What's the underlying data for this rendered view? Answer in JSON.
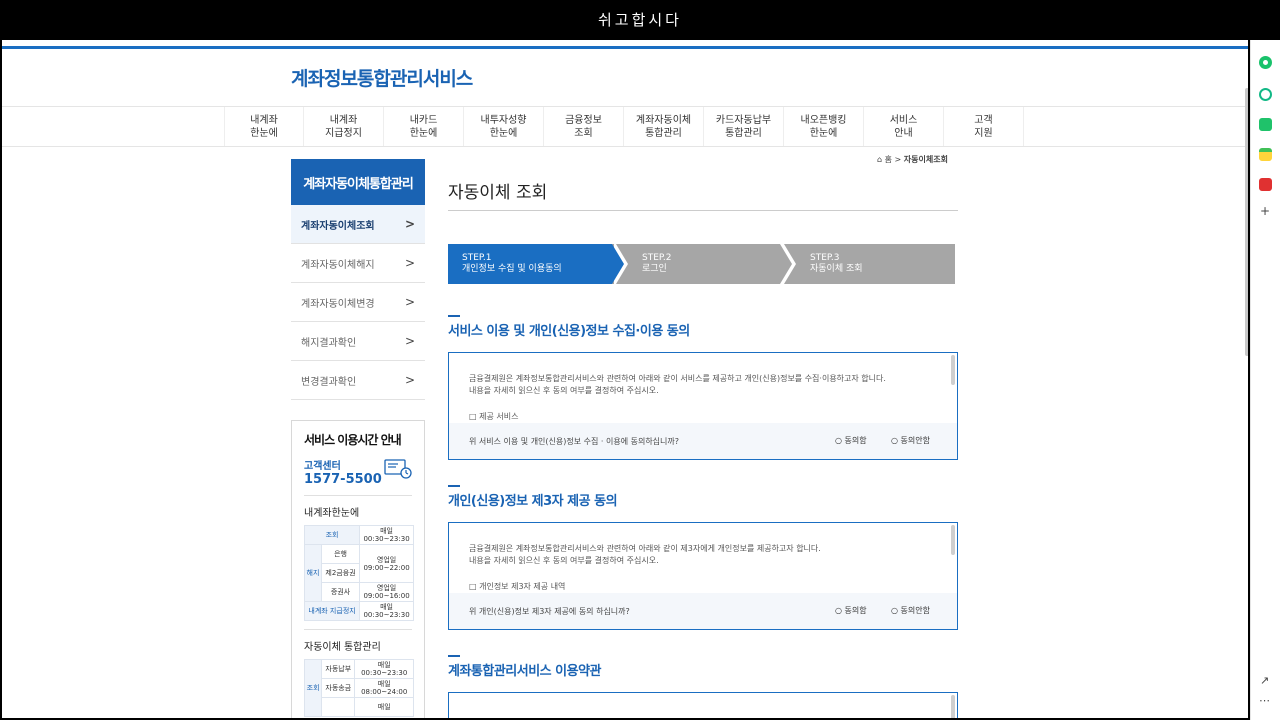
{
  "window_title": "쉬고합시다",
  "logo": "계좌정보통합관리서비스",
  "nav": [
    "내계좌\n한눈에",
    "내계좌\n지급정지",
    "내카드\n한눈에",
    "내투자성향\n한눈에",
    "금융정보\n조회",
    "계좌자동이체\n통합관리",
    "카드자동납부\n통합관리",
    "내오픈뱅킹\n한눈에",
    "서비스\n안내",
    "고객\n지원"
  ],
  "sidebar": {
    "title": "계좌자동이체통합관리",
    "items": [
      "계좌자동이체조회",
      "계좌자동이체해지",
      "계좌자동이체변경",
      "해지결과확인",
      "변경결과확인"
    ],
    "arrow": ">"
  },
  "info": {
    "title": "서비스 이용시간 안내",
    "cc_label": "고객센터",
    "cc_number": "1577-5500",
    "section1": "내계좌한눈에",
    "t1": {
      "r1": [
        "조회",
        "매일\n00:30~23:30"
      ],
      "bank": "은행",
      "jeo": "제2금융권",
      "wd": "영업일\n09:00~22:00",
      "cancel": "해지",
      "sec": "증권사",
      "sec_time": "영업일\n09:00~16:00",
      "stop": "내계좌 지급정지",
      "stop_time": "매일\n00:30~23:30"
    },
    "section2": "자동이체 통합관리",
    "t2": {
      "query": "조회",
      "pay": "자동납부",
      "pay_time": "매일\n00:30~23:30",
      "send": "자동송금",
      "send_time": "매일\n08:00~24:00",
      "more": "매일"
    }
  },
  "breadcrumb": {
    "home": "홈",
    "sep": ">",
    "current": "자동이체조회"
  },
  "page_title": "자동이체 조회",
  "steps": [
    {
      "label": "STEP.1\n개인정보 수집 및 이용동의",
      "active": true
    },
    {
      "label": "STEP.2\n로그인",
      "active": false
    },
    {
      "label": "STEP.3\n자동이체 조회",
      "active": false
    }
  ],
  "sections": [
    {
      "title": "서비스 이용 및 개인(신용)정보 수집·이용 동의",
      "text": "금융결제원은 계좌정보통합관리서비스와 관련하여 아래와 같이 서비스를 제공하고 개인(신용)정보를 수집·이용하고자 합니다.\n내용을 자세히 읽으신 후 동의 여부를 결정하여 주십시오.",
      "item": "□ 제공 서비스",
      "question": "위 서비스 이용 및 개인(신용)정보 수집 · 이용에 동의하십니까?",
      "agree": "동의함",
      "disagree": "동의안함"
    },
    {
      "title": "개인(신용)정보 제3자 제공 동의",
      "text": "금융결제원은 계좌정보통합관리서비스와 관련하여 아래와 같이 제3자에게 개인정보를 제공하고자 합니다.\n내용을 자세히 읽으신 후 동의 여부를 결정하여 주십시오.",
      "item": "□ 개인정보 제3자 제공 내역",
      "question": "위 개인(신용)정보 제3자 제공에 동의 하십니까?",
      "agree": "동의함",
      "disagree": "동의안함"
    },
    {
      "title": "계좌통합관리서비스 이용약관"
    }
  ],
  "colors": {
    "brand": "#1a63b3",
    "step_active": "#1a6ec2",
    "step_inactive": "#a6a6a6"
  }
}
